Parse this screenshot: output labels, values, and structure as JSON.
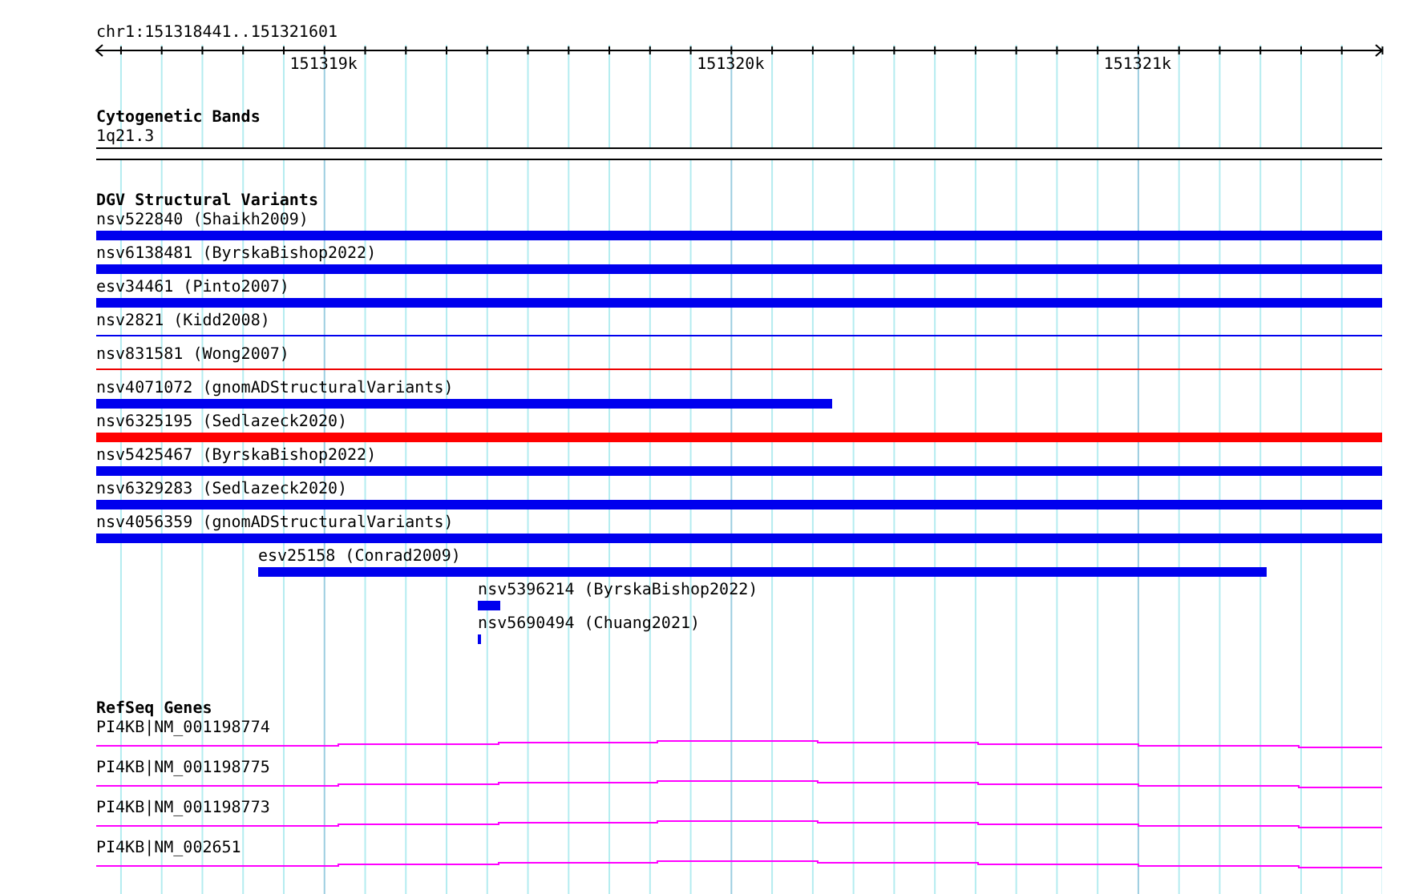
{
  "locus": "chr1:151318441..151321601",
  "ruler": {
    "ticks": [
      {
        "label": "151319k"
      },
      {
        "label": "151320k"
      },
      {
        "label": "151321k"
      }
    ]
  },
  "cytoband_track": {
    "title": "Cytogenetic Bands",
    "bands": [
      {
        "name": "1q21.3"
      }
    ]
  },
  "dgv_track": {
    "title": "DGV Structural Variants",
    "features": [
      {
        "label": "nsv522840 (Shaikh2009)",
        "kind": "thick",
        "color": "#0000ee"
      },
      {
        "label": "nsv6138481 (ByrskaBishop2022)",
        "kind": "thick",
        "color": "#0000ee"
      },
      {
        "label": "esv34461 (Pinto2007)",
        "kind": "thick",
        "color": "#0000ee"
      },
      {
        "label": "nsv2821 (Kidd2008)",
        "kind": "thin",
        "color": "#0000ee"
      },
      {
        "label": "nsv831581 (Wong2007)",
        "kind": "thin",
        "color": "#ee0000"
      },
      {
        "label": "nsv4071072 (gnomADStructuralVariants)",
        "kind": "thick",
        "color": "#0000ee"
      },
      {
        "label": "nsv6325195 (Sedlazeck2020)",
        "kind": "thick",
        "color": "#ff0000"
      },
      {
        "label": "nsv5425467 (ByrskaBishop2022)",
        "kind": "thick",
        "color": "#0000ee"
      },
      {
        "label": "nsv6329283 (Sedlazeck2020)",
        "kind": "thick",
        "color": "#0000ee"
      },
      {
        "label": "nsv4056359 (gnomADStructuralVariants)",
        "kind": "thick",
        "color": "#0000ee"
      },
      {
        "label": "esv25158 (Conrad2009)",
        "kind": "thick",
        "color": "#0000ee"
      },
      {
        "label": "nsv5396214 (ByrskaBishop2022)",
        "kind": "thick",
        "color": "#0000ee"
      },
      {
        "label": "nsv5690494 (Chuang2021)",
        "kind": "thick",
        "color": "#0000ee"
      }
    ]
  },
  "refseq_track": {
    "title": "RefSeq Genes",
    "genes": [
      {
        "label": "PI4KB|NM_001198774"
      },
      {
        "label": "PI4KB|NM_001198775"
      },
      {
        "label": "PI4KB|NM_001198773"
      },
      {
        "label": "PI4KB|NM_002651"
      }
    ]
  }
}
